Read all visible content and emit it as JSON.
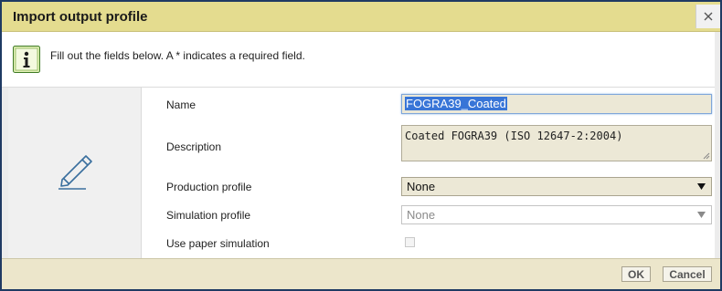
{
  "dialog": {
    "title": "Import output profile",
    "close_icon": "close-icon"
  },
  "info": {
    "icon": "info-icon",
    "text": "Fill out the fields below. A * indicates a required field."
  },
  "form": {
    "side_icon": "pencil-icon",
    "name": {
      "label": "Name",
      "value": "FOGRA39_Coated"
    },
    "description": {
      "label": "Description",
      "value": "Coated FOGRA39 (ISO 12647-2:2004)"
    },
    "production_profile": {
      "label": "Production profile",
      "selected": "None"
    },
    "simulation_profile": {
      "label": "Simulation profile",
      "selected": "None"
    },
    "use_paper_simulation": {
      "label": "Use paper simulation",
      "checked": false
    }
  },
  "footer": {
    "ok_label": "OK",
    "cancel_label": "Cancel"
  },
  "colors": {
    "titlebar": "#e4dc8f",
    "border": "#1f3a63",
    "footer": "#ece6cb",
    "input_bg": "#ece8d6",
    "selection": "#3875d7"
  }
}
